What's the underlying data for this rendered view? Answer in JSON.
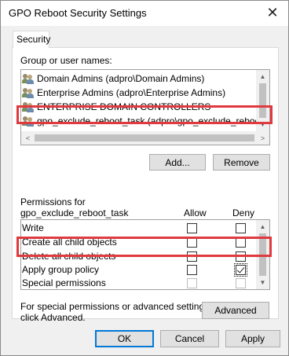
{
  "window": {
    "title": "GPO Reboot Security Settings",
    "close_glyph": "✕"
  },
  "tabs": [
    {
      "label": "Security"
    }
  ],
  "users": {
    "label": "Group or user names:",
    "items": [
      {
        "label": "Domain Admins (adpro\\Domain Admins)",
        "icon": "users-icon"
      },
      {
        "label": "Enterprise Admins (adpro\\Enterprise Admins)",
        "icon": "users-icon"
      },
      {
        "label": "ENTERPRISE DOMAIN CONTROLLERS",
        "icon": "users-icon"
      },
      {
        "label": "gpo_exclude_reboot_task (adpro\\gpo_exclude_reboot_tas",
        "icon": "users-icon",
        "selected": true
      }
    ],
    "scroll_left": "<",
    "scroll_right": ">",
    "scroll_up": "▲",
    "scroll_down": "▼"
  },
  "buttons": {
    "add": "Add...",
    "remove": "Remove",
    "advanced": "Advanced",
    "ok": "OK",
    "cancel": "Cancel",
    "apply": "Apply"
  },
  "permissions": {
    "heading_line1": "Permissions for",
    "heading_line2": "gpo_exclude_reboot_task",
    "allow_header": "Allow",
    "deny_header": "Deny",
    "rows": [
      {
        "name": "Write",
        "allow": false,
        "deny": false
      },
      {
        "name": "Create all child objects",
        "allow": false,
        "deny": false
      },
      {
        "name": "Delete all child objects",
        "allow": false,
        "deny": false
      },
      {
        "name": "Apply group policy",
        "allow": false,
        "deny": true
      },
      {
        "name": "Special permissions",
        "allow": false,
        "deny": false,
        "disabled": true
      }
    ]
  },
  "advanced_note": {
    "line1": "For special permissions or advanced settings,",
    "line2": "click Advanced."
  },
  "colors": {
    "highlight": "#e0393e",
    "default_button": "#0078d7"
  }
}
